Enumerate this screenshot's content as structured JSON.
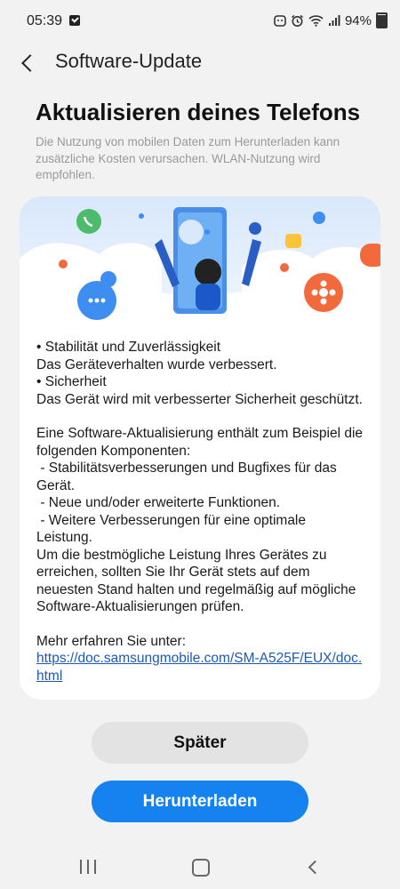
{
  "status_bar": {
    "time": "05:39",
    "battery": "94%",
    "icons": [
      "notification-check-icon",
      "face-icon",
      "alarm-icon",
      "wifi-icon",
      "signal-icon",
      "battery-icon"
    ]
  },
  "header": {
    "back_icon": "back-arrow-icon",
    "title": "Software-Update"
  },
  "main": {
    "title": "Aktualisieren deines Telefons",
    "subtitle": "Die Nutzung von mobilen Daten zum Herunterladen kann zusätzliche Kosten verursachen. WLAN-Nutzung wird empfohlen."
  },
  "notes": {
    "lines": [
      "• Stabilität und Zuverlässigkeit",
      "Das Geräteverhalten wurde verbessert.",
      "• Sicherheit",
      "Das Gerät wird mit verbesserter Sicherheit geschützt."
    ],
    "para2": [
      "Eine Software-Aktualisierung enthält zum Beispiel die folgenden Komponenten:",
      " - Stabilitätsverbesserungen und Bugfixes für das Gerät.",
      " - Neue und/oder erweiterte Funktionen.",
      " - Weitere Verbesserungen für eine optimale Leistung.",
      "Um die bestmögliche Leistung Ihres Gerätes zu erreichen, sollten Sie Ihr Gerät stets auf dem neuesten Stand halten und regelmäßig auf mögliche Software-Aktualisierungen prüfen."
    ],
    "more_label": "Mehr erfahren Sie unter:",
    "link": "https://doc.samsungmobile.com/SM-A525F/EUX/doc.html"
  },
  "buttons": {
    "later": "Später",
    "download": "Herunterladen"
  },
  "navbar": {
    "icons": [
      "recent-apps-icon",
      "home-icon",
      "back-icon"
    ]
  },
  "colors": {
    "accent": "#1582f0",
    "background": "#f2f2f2",
    "card": "#ffffff",
    "link": "#1a5ab8"
  }
}
